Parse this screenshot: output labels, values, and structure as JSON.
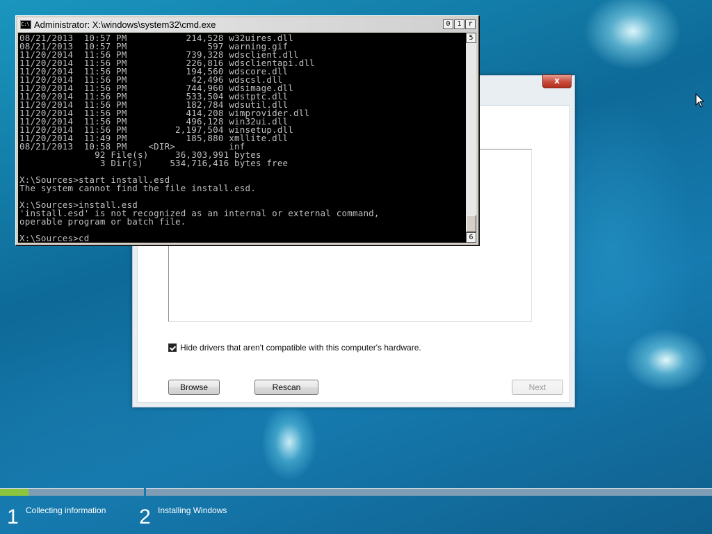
{
  "cmd": {
    "title": "Administrator: X:\\windows\\system32\\cmd.exe",
    "icon_text": "C:\\",
    "controls": [
      "0",
      "1",
      "r"
    ],
    "scroll_up": "5",
    "scroll_down": "6",
    "lines": [
      "08/21/2013  10:57 PM           214,528 w32uires.dll",
      "08/21/2013  10:57 PM               597 warning.gif",
      "11/20/2014  11:56 PM           739,328 wdsclient.dll",
      "11/20/2014  11:56 PM           226,816 wdsclientapi.dll",
      "11/20/2014  11:56 PM           194,560 wdscore.dll",
      "11/20/2014  11:56 PM            42,496 wdscsl.dll",
      "11/20/2014  11:56 PM           744,960 wdsimage.dll",
      "11/20/2014  11:56 PM           533,504 wdstptc.dll",
      "11/20/2014  11:56 PM           182,784 wdsutil.dll",
      "11/20/2014  11:56 PM           414,208 wimprovider.dll",
      "11/20/2014  11:56 PM           496,128 win32ui.dll",
      "11/20/2014  11:56 PM         2,197,504 winsetup.dll",
      "11/20/2014  11:49 PM           185,880 xmllite.dll",
      "08/21/2013  10:58 PM    <DIR>          inf",
      "              92 File(s)     36,303,991 bytes",
      "               3 Dir(s)     534,716,416 bytes free",
      "",
      "X:\\Sources>start install.esd",
      "The system cannot find the file install.esd.",
      "",
      "X:\\Sources>install.esd",
      "'install.esd' is not recognized as an internal or external command,",
      "operable program or batch file.",
      "",
      "X:\\Sources>cd"
    ]
  },
  "setup": {
    "close_label": "x",
    "hide_drivers_label": "Hide drivers that aren't compatible with this computer's hardware.",
    "hide_drivers_checked": true,
    "browse_label": "Browse",
    "rescan_label": "Rescan",
    "next_label": "Next",
    "next_enabled": false
  },
  "progress": {
    "step1_fill_fraction": 0.2,
    "step2_fill_fraction": 0.0,
    "fill_color": "#8cc63e",
    "steps": [
      {
        "number": "1",
        "label": "Collecting information"
      },
      {
        "number": "2",
        "label": "Installing Windows"
      }
    ]
  }
}
